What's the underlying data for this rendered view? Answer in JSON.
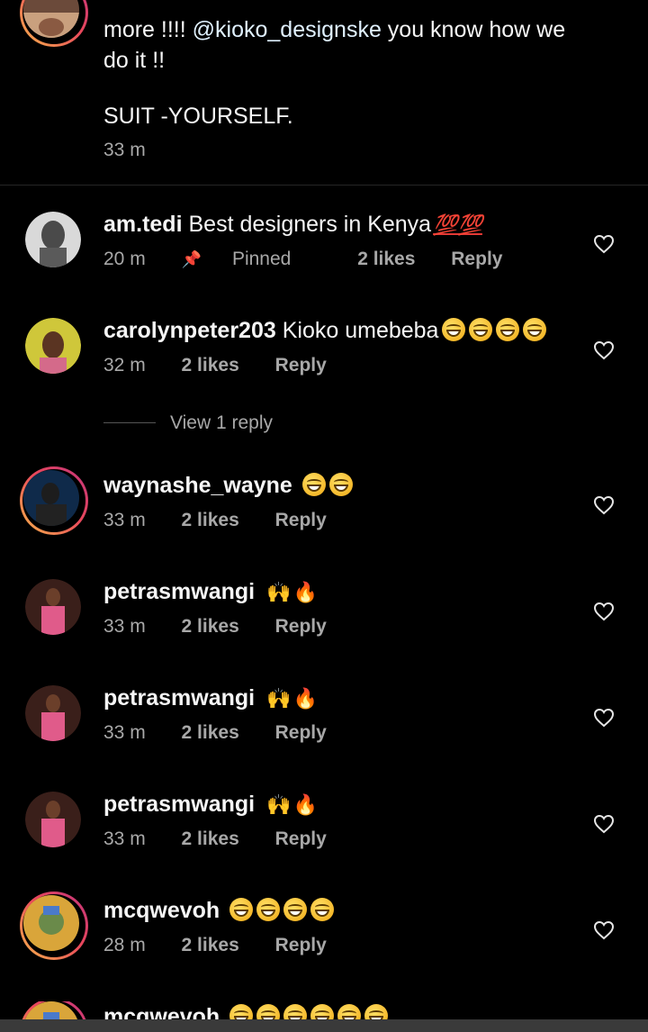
{
  "caption": {
    "line1_prefix": "more !!!! ",
    "mention": "@kioko_designske",
    "line1_suffix": " you know how we",
    "line2": "do it !!",
    "signoff": "SUIT -YOURSELF.",
    "time": "33 m"
  },
  "comments": [
    {
      "username": "am.tedi",
      "text": "Best designers in Kenya",
      "emoji": "💯💯",
      "time": "20 m",
      "pinned_label": "Pinned",
      "likes": "2 likes",
      "reply": "Reply"
    },
    {
      "username": "carolynpeter203",
      "text": "Kioko umebeba",
      "emoji": "😂😂😂😂",
      "time": "32 m",
      "likes": "2 likes",
      "reply": "Reply"
    },
    {
      "username": "waynashe_wayne",
      "text": "",
      "emoji": "😂😂",
      "time": "33 m",
      "likes": "2 likes",
      "reply": "Reply"
    },
    {
      "username": "petrasmwangi",
      "text": "",
      "emoji": "🙌🔥",
      "time": "33 m",
      "likes": "2 likes",
      "reply": "Reply"
    },
    {
      "username": "petrasmwangi",
      "text": "",
      "emoji": "🙌🔥",
      "time": "33 m",
      "likes": "2 likes",
      "reply": "Reply"
    },
    {
      "username": "petrasmwangi",
      "text": "",
      "emoji": "🙌🔥",
      "time": "33 m",
      "likes": "2 likes",
      "reply": "Reply"
    },
    {
      "username": "mcqwevoh",
      "text": "",
      "emoji": "😂😂😂😂",
      "time": "28 m",
      "likes": "2 likes",
      "reply": "Reply"
    },
    {
      "username": "mcqwevoh",
      "text": "",
      "emoji": "😂😂😂😂😂😂",
      "time": "",
      "likes": "",
      "reply": ""
    }
  ],
  "view_reply": "View 1 reply",
  "icons": {
    "heart": "heart-outline-icon",
    "pin": "pin-icon"
  },
  "colors": {
    "background": "#000000",
    "meta": "#a8a8a8",
    "story_ring": "#e9485b"
  }
}
